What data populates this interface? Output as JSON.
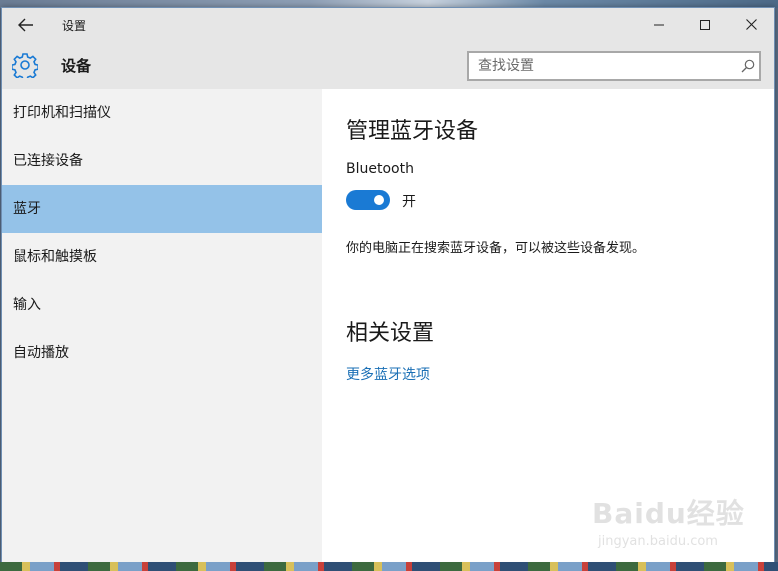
{
  "titlebar": {
    "title": "设置"
  },
  "header": {
    "section_title": "设备",
    "search": {
      "placeholder": "查找设置",
      "value": ""
    }
  },
  "sidebar": {
    "selected_index": 2,
    "items": [
      {
        "label": "打印机和扫描仪"
      },
      {
        "label": "已连接设备"
      },
      {
        "label": "蓝牙"
      },
      {
        "label": "鼠标和触摸板"
      },
      {
        "label": "输入"
      },
      {
        "label": "自动播放"
      }
    ]
  },
  "content": {
    "heading": "管理蓝牙设备",
    "bluetooth_label": "Bluetooth",
    "toggle": {
      "on": true,
      "state_label": "开"
    },
    "description": "你的电脑正在搜索蓝牙设备，可以被这些设备发现。",
    "related_heading": "相关设置",
    "more_options_link": "更多蓝牙选项"
  },
  "watermark": {
    "logo": "Baidu经验",
    "url": "jingyan.baidu.com"
  },
  "colors": {
    "accent": "#1a7ad4",
    "selected_nav": "#94c2e8",
    "link": "#1a6fb5",
    "chrome": "#e6e6e6",
    "sidebar": "#f2f2f2"
  }
}
